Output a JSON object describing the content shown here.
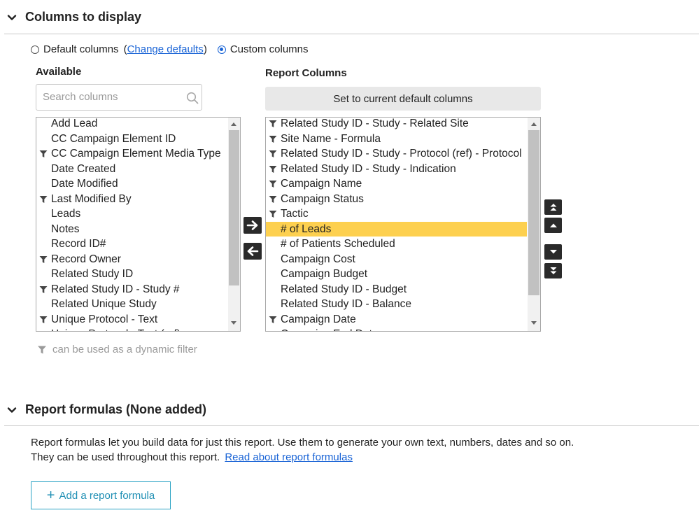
{
  "columns_section": {
    "title": "Columns to display",
    "default_columns_label": "Default columns",
    "paren_open": "(",
    "change_defaults_link": "Change defaults",
    "paren_close": ")",
    "custom_columns_label": "Custom columns",
    "selected_option": "custom"
  },
  "available": {
    "heading": "Available",
    "search_placeholder": "Search columns",
    "items": [
      {
        "label": "Add Lead",
        "filter": false
      },
      {
        "label": "CC Campaign Element ID",
        "filter": false
      },
      {
        "label": "CC Campaign Element Media Type",
        "filter": true
      },
      {
        "label": "Date Created",
        "filter": false
      },
      {
        "label": "Date Modified",
        "filter": false
      },
      {
        "label": "Last Modified By",
        "filter": true
      },
      {
        "label": "Leads",
        "filter": false
      },
      {
        "label": "Notes",
        "filter": false
      },
      {
        "label": "Record ID#",
        "filter": false
      },
      {
        "label": "Record Owner",
        "filter": true
      },
      {
        "label": "Related Study ID",
        "filter": false
      },
      {
        "label": "Related Study ID - Study #",
        "filter": true
      },
      {
        "label": "Related Unique Study",
        "filter": false
      },
      {
        "label": "Unique Protocol - Text",
        "filter": true
      },
      {
        "label": "Unique Protocol - Text (ref)",
        "filter": false
      }
    ]
  },
  "report_columns": {
    "heading": "Report Columns",
    "set_default_button": "Set to current default columns",
    "selected_item": "# of Leads",
    "items": [
      {
        "label": "Related Study ID - Study - Related Site",
        "filter": true
      },
      {
        "label": "Site Name - Formula",
        "filter": true
      },
      {
        "label": "Related Study ID - Study - Protocol (ref) - Protocol",
        "filter": true
      },
      {
        "label": "Related Study ID - Study - Indication",
        "filter": true
      },
      {
        "label": "Campaign Name",
        "filter": true
      },
      {
        "label": "Campaign Status",
        "filter": true
      },
      {
        "label": "Tactic",
        "filter": true
      },
      {
        "label": "# of Leads",
        "filter": false
      },
      {
        "label": "# of Patients Scheduled",
        "filter": false
      },
      {
        "label": "Campaign Cost",
        "filter": false
      },
      {
        "label": "Campaign Budget",
        "filter": false
      },
      {
        "label": "Related Study ID - Budget",
        "filter": false
      },
      {
        "label": "Related Study ID - Balance",
        "filter": false
      },
      {
        "label": "Campaign Date",
        "filter": true
      },
      {
        "label": "Campaign End Date",
        "filter": true
      }
    ]
  },
  "filter_note": "can be used as a dynamic filter",
  "formulas_section": {
    "title": "Report formulas (None added)",
    "line1": "Report formulas let you build data for just this report. Use them to generate your own text, numbers, dates and so on.",
    "line2": "They can be used throughout this report.",
    "read_link": "Read about report formulas",
    "add_button_icon": "+",
    "add_button_label": "Add a report formula"
  },
  "colors": {
    "link": "#1a64d6",
    "selected_row": "#fdd04f",
    "outline_button": "#2aa3c4",
    "dark_button": "#2a2a2a"
  },
  "icons": [
    "chevron-down-icon",
    "search-icon",
    "filter-icon",
    "arrow-right-icon",
    "arrow-left-icon",
    "move-top-icon",
    "move-up-icon",
    "move-down-icon",
    "move-bottom-icon"
  ]
}
